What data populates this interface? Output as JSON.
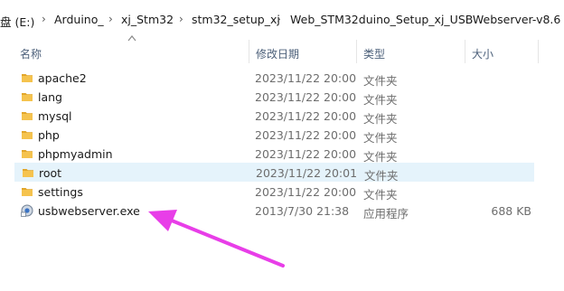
{
  "breadcrumb": {
    "drive": "盘 (E:)",
    "items": [
      "Arduino_",
      "xj_Stm32",
      "stm32_setup_xj",
      "Web_STM32duino_Setup_xj_USBWebserver-v8.6"
    ]
  },
  "columns": {
    "name": "名称",
    "modified": "修改日期",
    "type": "类型",
    "size": "大小"
  },
  "files": [
    {
      "name": "apache2",
      "modified": "2023/11/22 20:00",
      "type": "文件夹",
      "size": "",
      "icon": "folder-icon"
    },
    {
      "name": "lang",
      "modified": "2023/11/22 20:00",
      "type": "文件夹",
      "size": "",
      "icon": "folder-icon"
    },
    {
      "name": "mysql",
      "modified": "2023/11/22 20:00",
      "type": "文件夹",
      "size": "",
      "icon": "folder-icon"
    },
    {
      "name": "php",
      "modified": "2023/11/22 20:00",
      "type": "文件夹",
      "size": "",
      "icon": "folder-icon"
    },
    {
      "name": "phpmyadmin",
      "modified": "2023/11/22 20:00",
      "type": "文件夹",
      "size": "",
      "icon": "folder-icon"
    },
    {
      "name": "root",
      "modified": "2023/11/22 20:01",
      "type": "文件夹",
      "size": "",
      "icon": "folder-icon",
      "selected": true
    },
    {
      "name": "settings",
      "modified": "2023/11/22 20:00",
      "type": "文件夹",
      "size": "",
      "icon": "folder-icon"
    },
    {
      "name": "usbwebserver.exe",
      "modified": "2013/7/30 21:38",
      "type": "应用程序",
      "size": "688 KB",
      "icon": "exe-icon"
    }
  ],
  "colors": {
    "folder": "#f5c34e",
    "folder_dark": "#e2a62a",
    "selected_row": "#e5f3fb",
    "header_text": "#4c607a",
    "annotation_arrow": "#e83ee8"
  }
}
